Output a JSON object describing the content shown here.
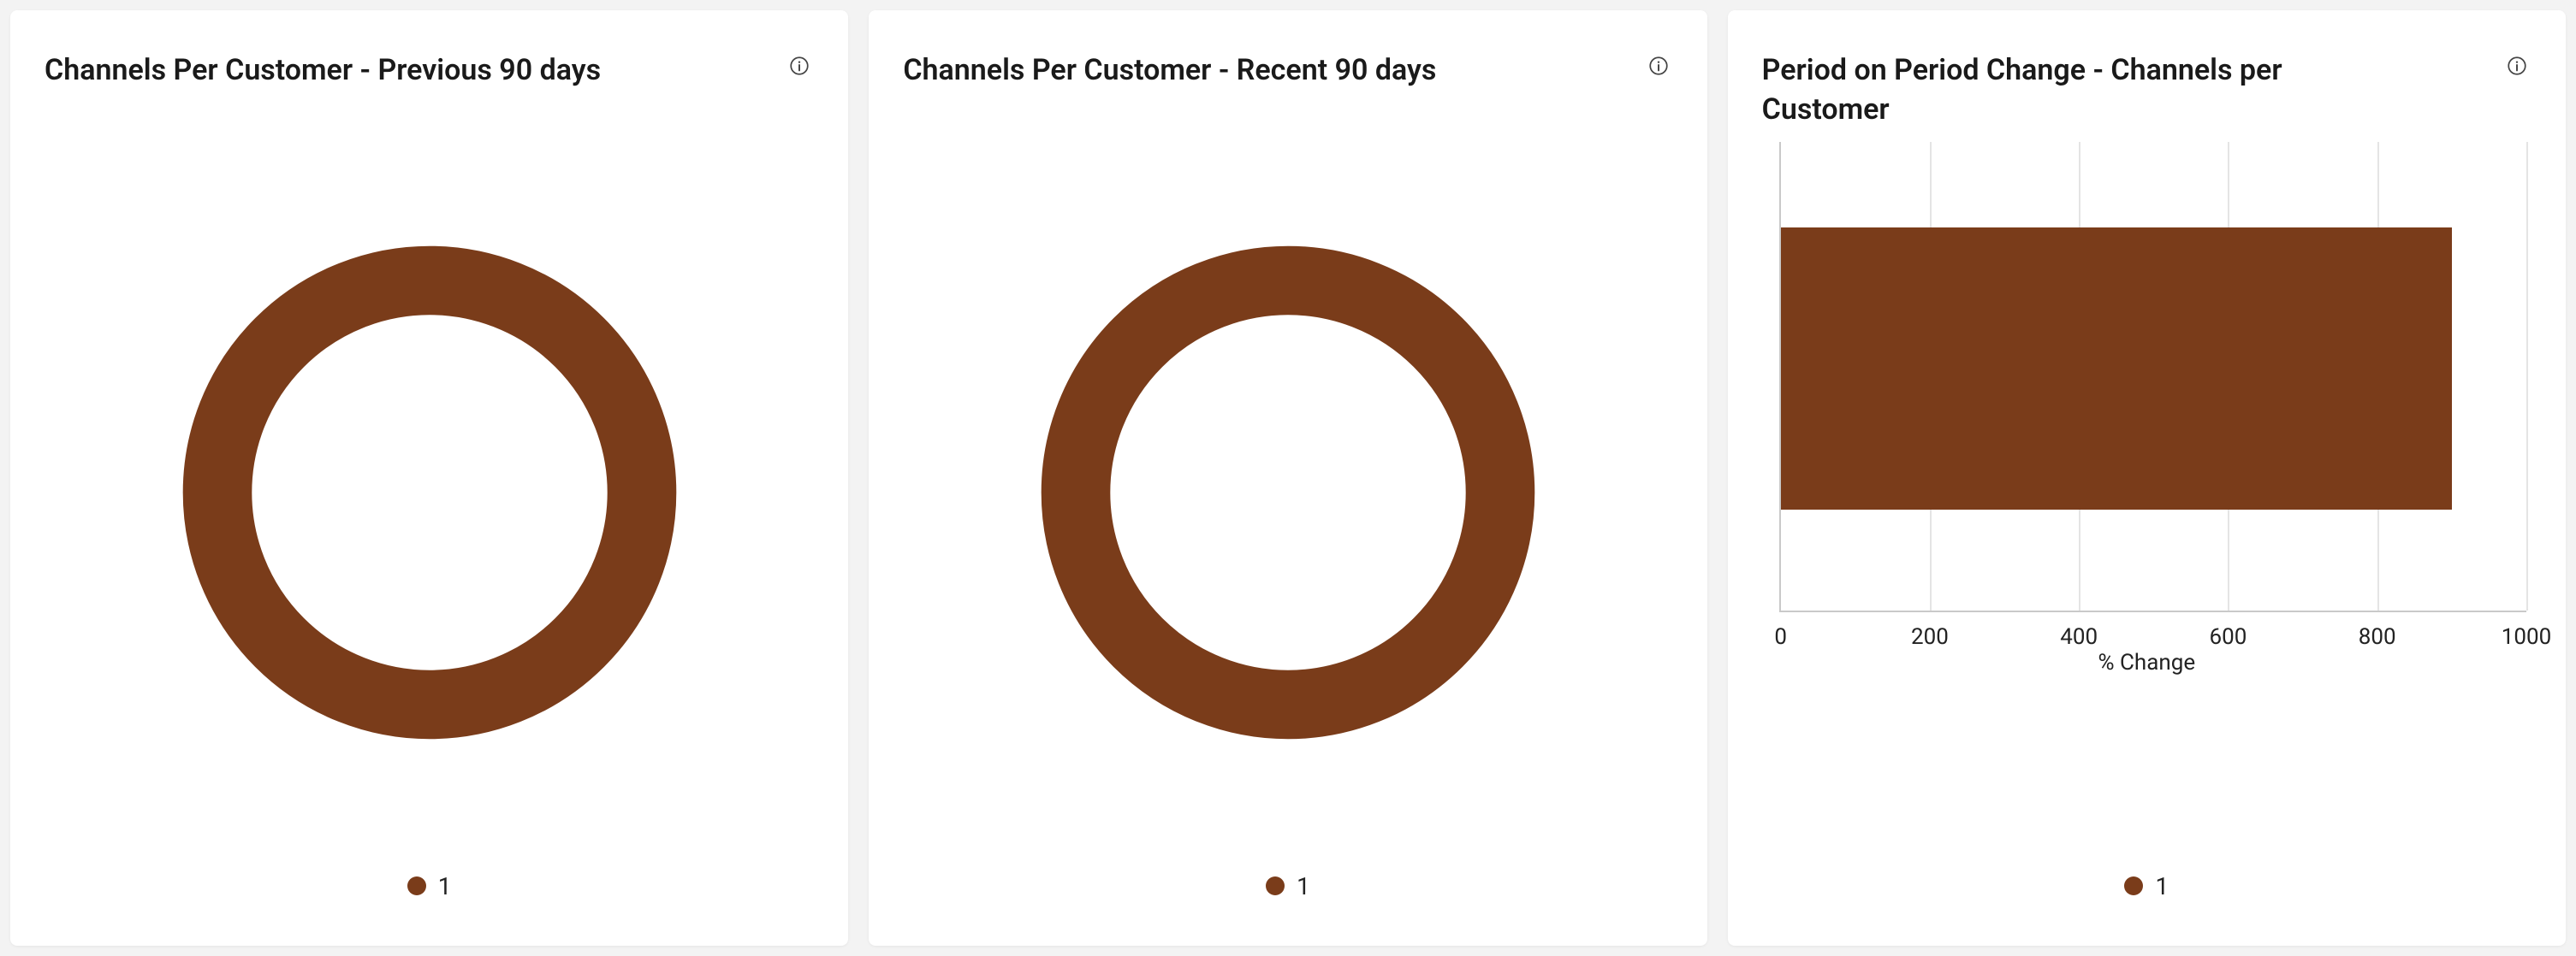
{
  "accent_color": "#7a3c1a",
  "cards": [
    {
      "title": "Channels Per Customer - Previous 90 days",
      "type": "pie",
      "legend": [
        {
          "label": "1",
          "color": "#7a3c1a"
        }
      ]
    },
    {
      "title": "Channels Per Customer - Recent 90 days",
      "type": "pie",
      "legend": [
        {
          "label": "1",
          "color": "#7a3c1a"
        }
      ]
    },
    {
      "title": "Period on Period Change - Channels per Customer",
      "type": "bar",
      "xlabel": "% Change",
      "xticks": [
        0,
        200,
        400,
        600,
        800,
        1000
      ],
      "xlim": [
        0,
        1000
      ],
      "series": [
        {
          "category": "1",
          "value": 900,
          "color": "#7a3c1a"
        }
      ],
      "legend": [
        {
          "label": "1",
          "color": "#7a3c1a"
        }
      ]
    }
  ],
  "chart_data": [
    {
      "type": "pie",
      "title": "Channels Per Customer - Previous 90 days",
      "categories": [
        "1"
      ],
      "values": [
        100
      ],
      "series": [
        {
          "name": "1",
          "value": 100
        }
      ]
    },
    {
      "type": "pie",
      "title": "Channels Per Customer - Recent 90 days",
      "categories": [
        "1"
      ],
      "values": [
        100
      ],
      "series": [
        {
          "name": "1",
          "value": 100
        }
      ]
    },
    {
      "type": "bar",
      "orientation": "horizontal",
      "title": "Period on Period Change - Channels per Customer",
      "xlabel": "% Change",
      "ylabel": "",
      "xlim": [
        0,
        1000
      ],
      "xticks": [
        0,
        200,
        400,
        600,
        800,
        1000
      ],
      "categories": [
        "1"
      ],
      "values": [
        900
      ],
      "series": [
        {
          "name": "1",
          "values": [
            900
          ]
        }
      ]
    }
  ]
}
